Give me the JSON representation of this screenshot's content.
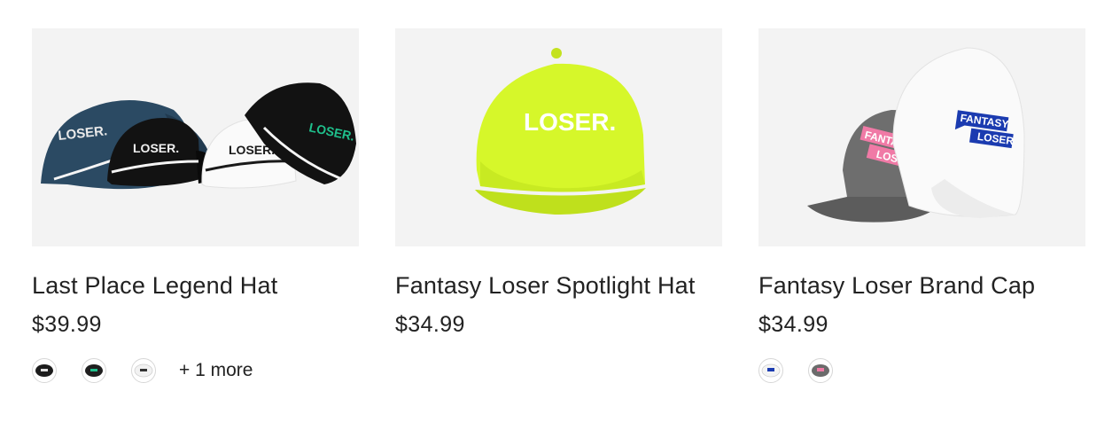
{
  "products": [
    {
      "title": "Last Place Legend Hat",
      "price": "$39.99",
      "image_text": [
        "LOSER.",
        "LOSER.",
        "LOSER.",
        "LOSER."
      ],
      "swatches": [
        {
          "color": "#1c1c1c",
          "icon": "hat-swatch-black"
        },
        {
          "color": "#1f1f1f",
          "icon": "hat-swatch-black-green"
        },
        {
          "color": "#f2f2f2",
          "icon": "hat-swatch-white"
        }
      ],
      "more_label": "+ 1 more"
    },
    {
      "title": "Fantasy Loser Spotlight Hat",
      "price": "$34.99",
      "image_text": [
        "LOSER."
      ],
      "swatches": []
    },
    {
      "title": "Fantasy Loser Brand Cap",
      "price": "$34.99",
      "image_text": [
        "FANTASY",
        "LOSER",
        "FANTASY",
        "LOSER"
      ],
      "swatches": [
        {
          "color": "#f4f4f4",
          "icon": "hat-swatch-white-blue"
        },
        {
          "color": "#6b6b6b",
          "icon": "hat-swatch-gray-pink"
        }
      ]
    }
  ],
  "colors": {
    "navy": "#2b4a63",
    "black": "#141414",
    "white": "#ffffff",
    "neon": "#d6f72a",
    "gray": "#6e6e6e",
    "pink": "#f07aa6",
    "blue": "#1b3bb0",
    "green": "#1fc08c"
  }
}
